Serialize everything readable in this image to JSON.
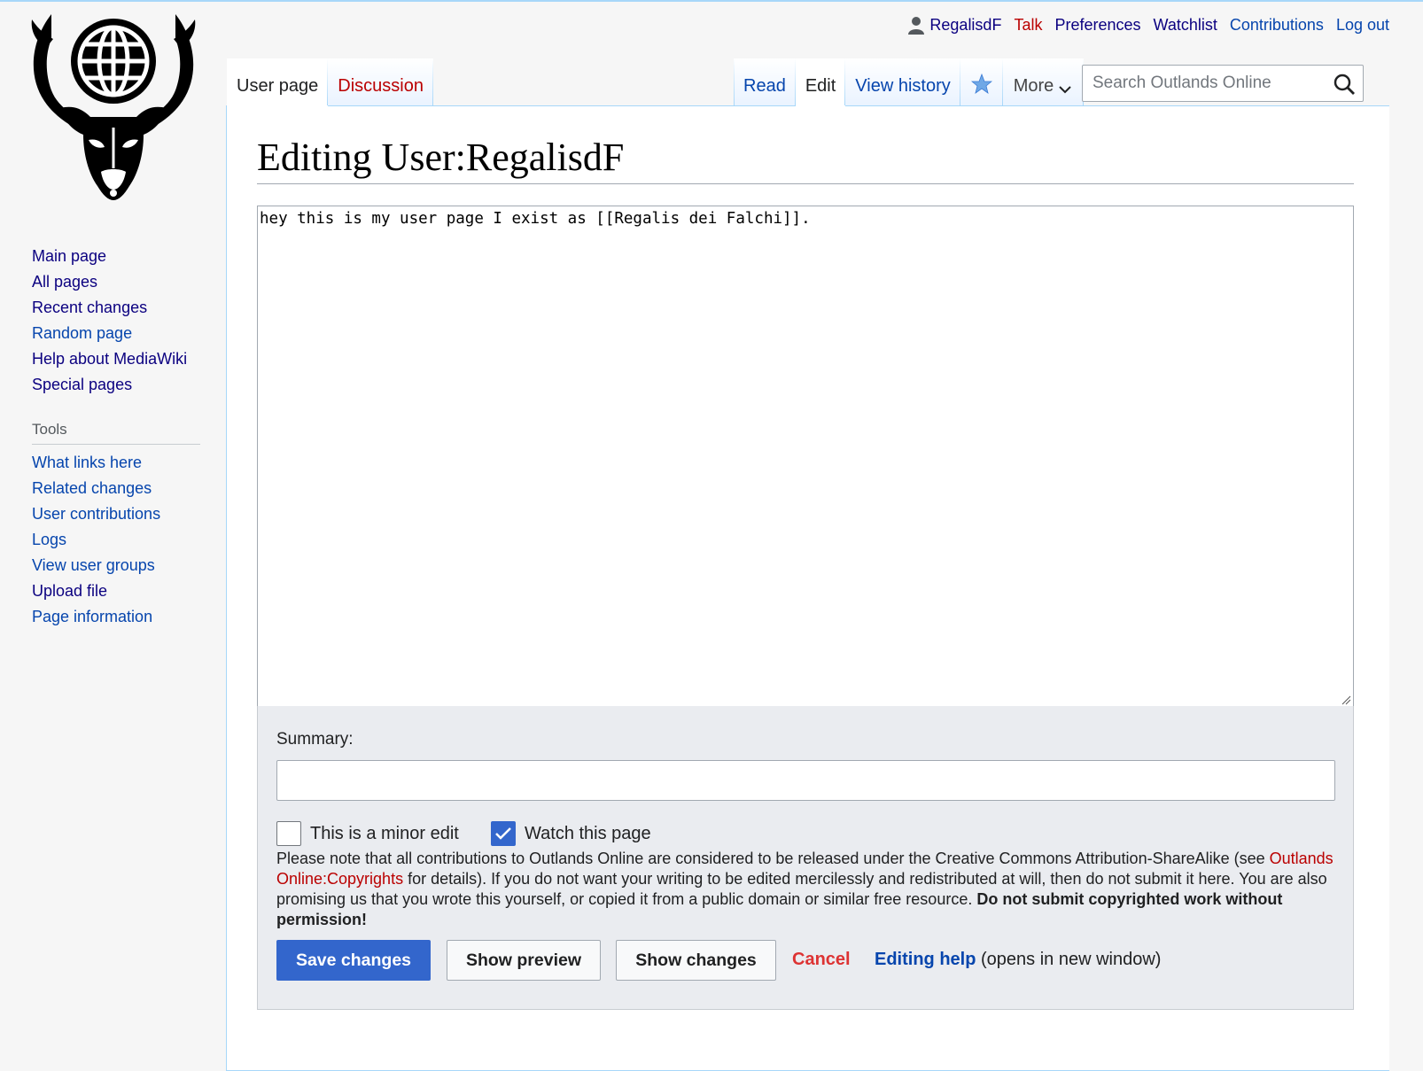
{
  "personal": {
    "username": "RegalisdF",
    "talk": "Talk",
    "preferences": "Preferences",
    "watchlist": "Watchlist",
    "contributions": "Contributions",
    "logout": "Log out"
  },
  "tabs": {
    "user_page": "User page",
    "discussion": "Discussion",
    "read": "Read",
    "edit": "Edit",
    "view_history": "View history",
    "more": "More"
  },
  "search": {
    "placeholder": "Search Outlands Online"
  },
  "sidebar": {
    "nav": [
      "Main page",
      "All pages",
      "Recent changes",
      "Random page",
      "Help about MediaWiki",
      "Special pages"
    ],
    "tools_heading": "Tools",
    "tools": [
      "What links here",
      "Related changes",
      "User contributions",
      "Logs",
      "View user groups",
      "Upload file",
      "Page information"
    ]
  },
  "page": {
    "title": "Editing User:RegalisdF",
    "editor_text": "hey this is my user page I exist as [[Regalis dei Falchi]]."
  },
  "edit_options": {
    "summary_label": "Summary:",
    "summary_value": "",
    "minor_edit_label": "This is a minor edit",
    "minor_edit_checked": false,
    "watch_label": "Watch this page",
    "watch_checked": true,
    "license_text_1": "Please note that all contributions to Outlands Online are considered to be released under the Creative Commons Attribution-ShareAlike (see ",
    "license_link": "Outlands Online:Copyrights",
    "license_text_2": " for details). If you do not want your writing to be edited mercilessly and redistributed at will, then do not submit it here. You are also promising us that you wrote this yourself, or copied it from a public domain or similar free resource. ",
    "license_bold": "Do not submit copyrighted work without permission!",
    "save_button": "Save changes",
    "preview_button": "Show preview",
    "changes_button": "Show changes",
    "cancel": "Cancel",
    "help_link": "Editing help",
    "help_note": "(opens in new window)"
  },
  "colors": {
    "link": "#0645ad",
    "visited_link": "#0b0080",
    "new_link": "#ba0000",
    "primary_button": "#3366cc",
    "cancel": "#d33",
    "tab_border": "#a7d7f9"
  }
}
